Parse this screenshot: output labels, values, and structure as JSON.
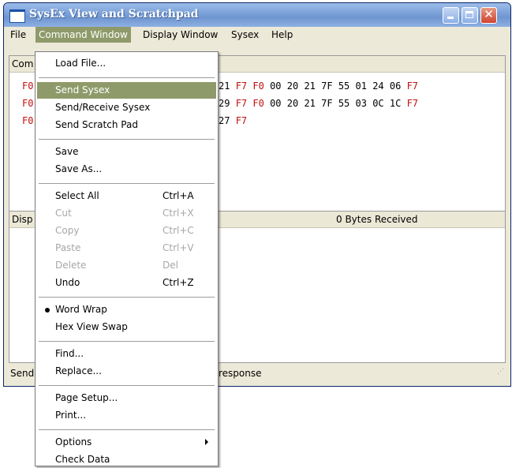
{
  "window": {
    "title": "SysEx View and Scratchpad"
  },
  "menubar": [
    "File",
    "Command Window",
    "Display Window",
    "Sysex",
    "Help"
  ],
  "command_pane": {
    "header_visible": "Com",
    "lines": [
      {
        "left": "F0",
        "right": [
          [
            "21",
            "n"
          ],
          [
            "F7",
            "r"
          ],
          [
            "F0",
            "r"
          ],
          [
            "00",
            "n"
          ],
          [
            "20",
            "n"
          ],
          [
            "21",
            "n"
          ],
          [
            "7F",
            "n"
          ],
          [
            "55",
            "n"
          ],
          [
            "01",
            "n"
          ],
          [
            "24",
            "n"
          ],
          [
            "06",
            "n"
          ],
          [
            "F7",
            "r"
          ]
        ]
      },
      {
        "left": "F0",
        "right": [
          [
            "29",
            "n"
          ],
          [
            "F7",
            "r"
          ],
          [
            "F0",
            "r"
          ],
          [
            "00",
            "n"
          ],
          [
            "20",
            "n"
          ],
          [
            "21",
            "n"
          ],
          [
            "7F",
            "n"
          ],
          [
            "55",
            "n"
          ],
          [
            "03",
            "n"
          ],
          [
            "0C",
            "n"
          ],
          [
            "1C",
            "n"
          ],
          [
            "F7",
            "r"
          ]
        ]
      },
      {
        "left": "F0",
        "right": [
          [
            "27",
            "n"
          ],
          [
            "F7",
            "r"
          ]
        ]
      }
    ]
  },
  "display_pane": {
    "header_visible": "Disp",
    "bytes_received": "0  Bytes Received"
  },
  "status_bar": {
    "left": "Send",
    "right": "response"
  },
  "menu": {
    "items": [
      {
        "label": "Load File..."
      },
      {
        "sep": true
      },
      {
        "label": "Send Sysex",
        "highlighted": true
      },
      {
        "label": "Send/Receive Sysex"
      },
      {
        "label": "Send Scratch Pad"
      },
      {
        "sep": true
      },
      {
        "label": "Save"
      },
      {
        "label": "Save As..."
      },
      {
        "sep": true
      },
      {
        "label": "Select All",
        "shortcut": "Ctrl+A"
      },
      {
        "label": "Cut",
        "shortcut": "Ctrl+X",
        "disabled": true
      },
      {
        "label": "Copy",
        "shortcut": "Ctrl+C",
        "disabled": true
      },
      {
        "label": "Paste",
        "shortcut": "Ctrl+V",
        "disabled": true
      },
      {
        "label": "Delete",
        "shortcut": "Del",
        "disabled": true
      },
      {
        "label": "Undo",
        "shortcut": "Ctrl+Z"
      },
      {
        "sep": true
      },
      {
        "label": "Word Wrap",
        "checked": true
      },
      {
        "label": "Hex View Swap"
      },
      {
        "sep": true
      },
      {
        "label": "Find..."
      },
      {
        "label": "Replace..."
      },
      {
        "sep": true
      },
      {
        "label": "Page Setup..."
      },
      {
        "label": "Print..."
      },
      {
        "sep": true
      },
      {
        "label": "Options",
        "submenu": true
      },
      {
        "label": "Check Data"
      }
    ]
  },
  "colors": {
    "highlight": "#8f9a6a",
    "hex_red": "#c01010"
  }
}
